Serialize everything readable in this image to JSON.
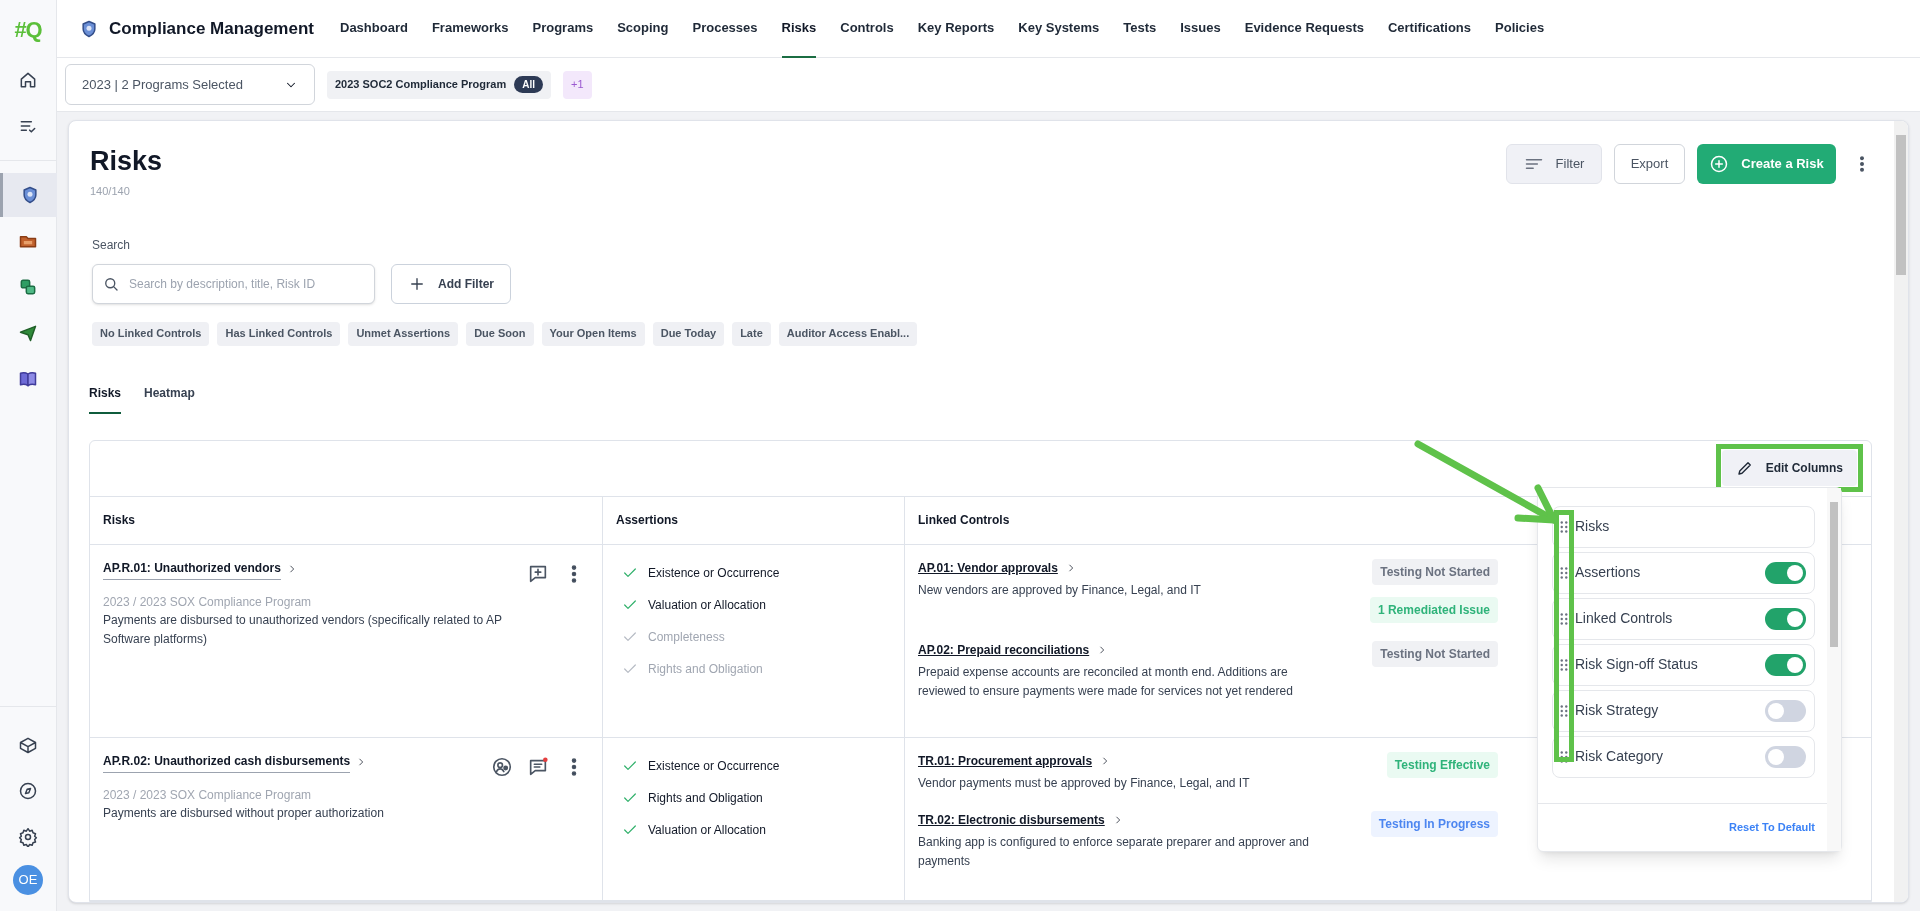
{
  "app": {
    "logo": "#Q",
    "title": "Compliance Management"
  },
  "nav": [
    {
      "label": "Dashboard",
      "selected": false
    },
    {
      "label": "Frameworks",
      "selected": false
    },
    {
      "label": "Programs",
      "selected": false
    },
    {
      "label": "Scoping",
      "selected": false
    },
    {
      "label": "Processes",
      "selected": false
    },
    {
      "label": "Risks",
      "selected": true
    },
    {
      "label": "Controls",
      "selected": false
    },
    {
      "label": "Key Reports",
      "selected": false
    },
    {
      "label": "Key Systems",
      "selected": false
    },
    {
      "label": "Tests",
      "selected": false
    },
    {
      "label": "Issues",
      "selected": false
    },
    {
      "label": "Evidence Requests",
      "selected": false
    },
    {
      "label": "Certifications",
      "selected": false
    },
    {
      "label": "Policies",
      "selected": false
    }
  ],
  "sidebar": {
    "top": [
      {
        "kind": "home",
        "selected": false
      },
      {
        "kind": "tasks",
        "selected": false
      }
    ],
    "apps": [
      {
        "kind": "shield",
        "selected": true
      },
      {
        "kind": "folder",
        "selected": false
      },
      {
        "kind": "sync",
        "selected": false
      },
      {
        "kind": "plane",
        "selected": false
      },
      {
        "kind": "book",
        "selected": false
      }
    ],
    "bottom": [
      {
        "kind": "box",
        "selected": false
      },
      {
        "kind": "compass",
        "selected": false
      },
      {
        "kind": "settings",
        "selected": false
      }
    ],
    "avatar": "OE"
  },
  "program_bar": {
    "selector": "2023 | 2 Programs Selected",
    "chip": "2023 SOC2 Compliance Program",
    "chip_badge": "All",
    "more": "+1"
  },
  "page": {
    "title": "Risks",
    "count": "140/140",
    "actions": {
      "filter": "Filter",
      "export": "Export",
      "create": "Create a Risk"
    }
  },
  "search": {
    "label": "Search",
    "placeholder": "Search by description, title, Risk ID",
    "add_filter": "Add Filter"
  },
  "quick_filters": [
    "No Linked Controls",
    "Has Linked Controls",
    "Unmet Assertions",
    "Due Soon",
    "Your Open Items",
    "Due Today",
    "Late",
    "Auditor Access Enabl..."
  ],
  "tabs": [
    {
      "label": "Risks",
      "selected": true
    },
    {
      "label": "Heatmap",
      "selected": false
    }
  ],
  "table": {
    "edit_columns": "Edit Columns",
    "columns": [
      "Risks",
      "Assertions",
      "Linked Controls"
    ],
    "rows": [
      {
        "title": "AP.R.01: Unauthorized vendors",
        "program": "2023 / 2023 SOX Compliance Program",
        "description": "Payments are disbursed to unauthorized vendors (specifically related to AP Software platforms)",
        "auditor_assigned": false,
        "unread_comments": false,
        "assertions": [
          {
            "label": "Existence or Occurrence",
            "met": true
          },
          {
            "label": "Valuation or Allocation",
            "met": true
          },
          {
            "label": "Completeness",
            "met": false
          },
          {
            "label": "Rights and Obligation",
            "met": false
          }
        ],
        "controls": [
          {
            "title": "AP.01: Vendor approvals",
            "description": "New vendors are approved by Finance, Legal, and IT",
            "statuses": [
              {
                "label": "Testing Not Started",
                "kind": "neutral"
              },
              {
                "label": "1 Remediated Issue",
                "kind": "success"
              }
            ]
          },
          {
            "title": "AP.02: Prepaid reconciliations",
            "description": "Prepaid expense accounts are reconciled at month end. Additions are reviewed to ensure payments were made for services not yet rendered",
            "statuses": [
              {
                "label": "Testing Not Started",
                "kind": "neutral"
              }
            ]
          }
        ]
      },
      {
        "title": "AP.R.02: Unauthorized cash disbursements",
        "program": "2023 / 2023 SOX Compliance Program",
        "description": "Payments are disbursed without proper authorization",
        "auditor_assigned": true,
        "unread_comments": true,
        "assertions": [
          {
            "label": "Existence or Occurrence",
            "met": true
          },
          {
            "label": "Rights and Obligation",
            "met": true
          },
          {
            "label": "Valuation or Allocation",
            "met": true
          }
        ],
        "controls": [
          {
            "title": "TR.01: Procurement approvals",
            "description": "Vendor payments must be approved by Finance, Legal, and IT",
            "statuses": [
              {
                "label": "Testing Effective",
                "kind": "success"
              }
            ]
          },
          {
            "title": "TR.02: Electronic disbursements",
            "description": "Banking app is configured to enforce separate preparer and approver and payments",
            "statuses": [
              {
                "label": "Testing In Progress",
                "kind": "info"
              }
            ]
          }
        ]
      }
    ]
  },
  "column_picker": {
    "items": [
      {
        "label": "Risks",
        "kind": "fixed"
      },
      {
        "label": "Assertions",
        "kind": "toggle",
        "on": true
      },
      {
        "label": "Linked Controls",
        "kind": "toggle",
        "on": true
      },
      {
        "label": "Risk Sign-off Status",
        "kind": "toggle",
        "on": true
      },
      {
        "label": "Risk Strategy",
        "kind": "toggle",
        "on": false
      },
      {
        "label": "Risk Category",
        "kind": "toggle",
        "on": false
      }
    ],
    "reset": "Reset To Default"
  }
}
